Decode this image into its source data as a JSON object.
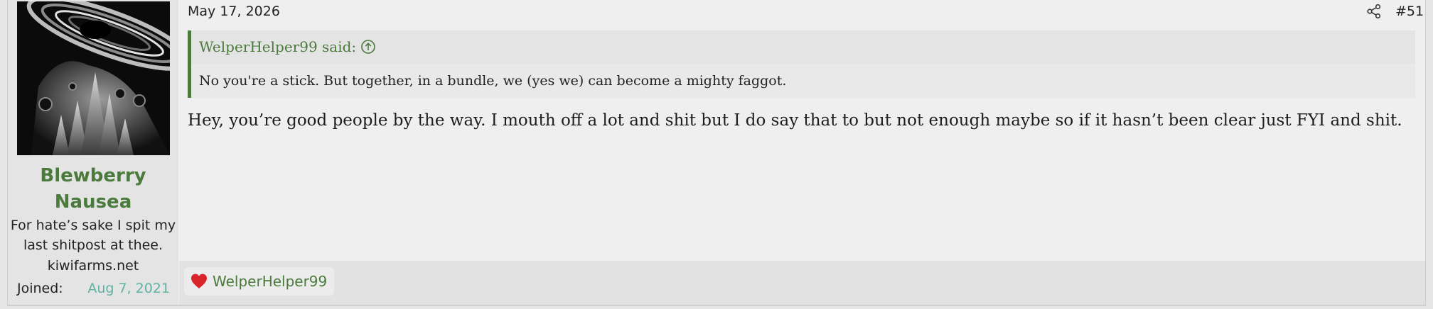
{
  "user": {
    "avatar_icon": "galaxy-artwork-avatar",
    "name": "Blewberry Nausea",
    "title": "For hate’s sake I spit my last shitpost at thee.",
    "site": "kiwifarms.net",
    "joined_label": "Joined:",
    "joined_value": "Aug 7, 2021"
  },
  "post": {
    "date": "May 17, 2026",
    "share_icon": "share-icon",
    "number": "#51",
    "quote": {
      "author_text": "WelperHelper99 said:",
      "jump_icon": "arrow-up-circle-icon",
      "body": "No you're a stick. But together, in a bundle, we (yes we) can become a mighty faggot."
    },
    "message": "Hey, you’re good people by the way. I mouth off a lot and shit but I do say that to but not enough maybe so if it hasn’t been clear just FYI and shit.",
    "reactions": [
      {
        "icon": "heart-icon",
        "user": "WelperHelper99"
      }
    ]
  },
  "colors": {
    "accent_green": "#4a7a3c",
    "joined_teal": "#5fb3a0",
    "heart_red": "#d9242b"
  }
}
